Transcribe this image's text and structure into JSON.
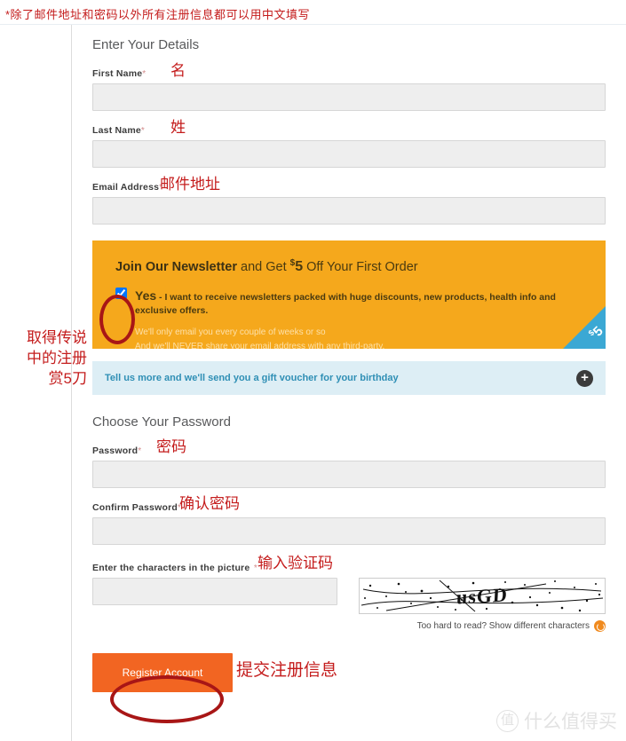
{
  "annotations": {
    "top_note": "*除了邮件地址和密码以外所有注册信息都可以用中文填写",
    "first_name": "名",
    "last_name": "姓",
    "email": "邮件地址",
    "newsletter_left": "取得传说\n中的注册\n赏5刀",
    "password": "密码",
    "confirm_password": "确认密码",
    "captcha": "输入验证码",
    "register": "提交注册信息"
  },
  "details_section": {
    "heading": "Enter Your Details",
    "fields": [
      {
        "label": "First Name",
        "required": "*",
        "value": ""
      },
      {
        "label": "Last Name",
        "required": "*",
        "value": ""
      },
      {
        "label": "Email Address",
        "required": "*",
        "value": ""
      }
    ]
  },
  "newsletter": {
    "title_bold": "Join Our Newsletter",
    "title_mid": " and Get ",
    "dollar_sign": "$",
    "amount": "5",
    "title_end": " Off Your First Order",
    "checkbox_checked": true,
    "yes_label": "Yes",
    "opt_text": " - I want to receive newsletters packed with huge discounts, new products, health info and exclusive offers.",
    "sub_line_1": "We'll only email you every couple of weeks or so",
    "sub_line_2": "And we'll NEVER share your email address with any third-party.",
    "badge_dollar": "$",
    "badge_amount": "5",
    "bg_color": "#F5A81C",
    "badge_color": "#3BA8D4"
  },
  "voucher": {
    "text": "Tell us more and we'll send you a gift voucher for your birthday",
    "expand_icon": "plus-icon",
    "bg_color": "#DDEEF5"
  },
  "password_section": {
    "heading": "Choose Your Password",
    "fields": [
      {
        "label": "Password",
        "required": "*",
        "value": ""
      },
      {
        "label": "Confirm Password",
        "required": "*",
        "value": ""
      }
    ]
  },
  "captcha": {
    "label": "Enter the characters in the picture",
    "required": "*",
    "value": "",
    "image_text": "usGD",
    "refresh_text": "Too hard to read? Show different characters",
    "refresh_icon": "refresh-icon"
  },
  "actions": {
    "register_label": "Register Account",
    "register_color": "#F26522"
  },
  "watermark": {
    "badge": "值",
    "text": "什么值得买"
  }
}
